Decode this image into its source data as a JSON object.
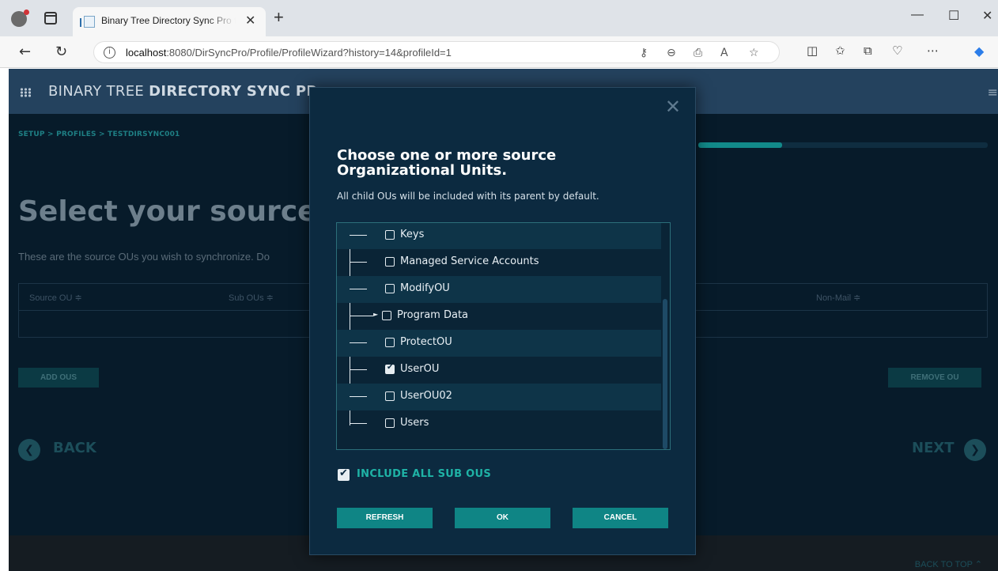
{
  "browser": {
    "tab_title": "Binary Tree Directory Sync Pro fo",
    "tab_close": "✕",
    "new_tab": "+",
    "url_host": "localhost",
    "url_rest": ":8080/DirSyncPro/Profile/ProfileWizard?history=14&profileId=1",
    "window_controls": {
      "minimize": "—",
      "maximize": "☐",
      "close": "✕"
    },
    "icons": [
      "back-arrow-icon",
      "refresh-icon",
      "info-icon",
      "key-icon",
      "zoom-icon",
      "share-icon",
      "read-aloud-icon",
      "favorite-icon",
      "split-screen-icon",
      "favorites-icon",
      "collections-icon",
      "health-icon",
      "more-icon",
      "copilot-icon"
    ]
  },
  "app": {
    "title_regular": "BINARY TREE ",
    "title_bold": "DIRECTORY SYNC PR",
    "breadcrumb": "SETUP > PROFILES > TESTDIRSYNC001",
    "progress_fraction": 0.29,
    "page_title": "Select your source",
    "page_desc": "These are the source OUs you wish to synchronize. Do",
    "table_headers": [
      "Source OU ≑",
      "Sub OUs ≑",
      "Non-Mail ≑"
    ],
    "add_button": "ADD OUS",
    "remove_button": "REMOVE OU",
    "back_label": "BACK",
    "next_label": "NEXT",
    "back_to_top": "BACK TO TOP ⌃"
  },
  "modal": {
    "close": "✕",
    "title": "Choose one or more source Organizational Units.",
    "subtitle": "All child OUs will be included with its parent by default.",
    "tree_items": [
      {
        "label": "Keys",
        "checked": false,
        "expandable": false
      },
      {
        "label": "Managed Service Accounts",
        "checked": false,
        "expandable": false
      },
      {
        "label": "ModifyOU",
        "checked": false,
        "expandable": false
      },
      {
        "label": "Program Data",
        "checked": false,
        "expandable": true
      },
      {
        "label": "ProtectOU",
        "checked": false,
        "expandable": false
      },
      {
        "label": "UserOU",
        "checked": true,
        "expandable": false
      },
      {
        "label": "UserOU02",
        "checked": false,
        "expandable": false
      },
      {
        "label": "Users",
        "checked": false,
        "expandable": false
      }
    ],
    "include_sub_ous_label": "INCLUDE ALL SUB OUS",
    "include_sub_ous_checked": true,
    "buttons": {
      "refresh": "REFRESH",
      "ok": "OK",
      "cancel": "CANCEL"
    },
    "accent_color": "#0f8585"
  }
}
